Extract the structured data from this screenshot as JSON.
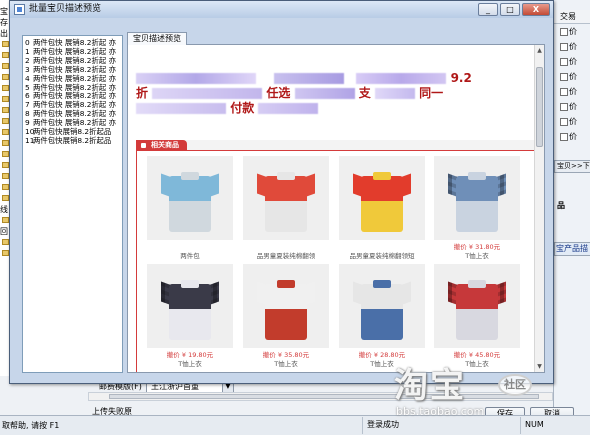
{
  "dialog": {
    "title": "批量宝贝描述预览",
    "controls": {
      "minimize": "_",
      "maximize": "□",
      "close": "X"
    },
    "tab_label": "宝贝描述预览"
  },
  "item_list": [
    {
      "index": "0",
      "text": "两件包快 展销8.2折起 亦"
    },
    {
      "index": "1",
      "text": "两件包快 展销8.2折起 亦"
    },
    {
      "index": "2",
      "text": "两件包快 展销8.2折起 亦"
    },
    {
      "index": "3",
      "text": "两件包快 展销8.2折起 亦"
    },
    {
      "index": "4",
      "text": "两件包快 展销8.2折起 亦"
    },
    {
      "index": "5",
      "text": "两件包快 展销8.2折起 亦"
    },
    {
      "index": "6",
      "text": "两件包快 展销8.2折起 亦"
    },
    {
      "index": "7",
      "text": "两件包快 展销8.2折起 亦"
    },
    {
      "index": "8",
      "text": "两件包快 展销8.2折起 亦"
    },
    {
      "index": "9",
      "text": "两件包快 展销8.2折起 亦"
    },
    {
      "index": "10",
      "text": "两件包快展销8.2折起品"
    },
    {
      "index": "11",
      "text": "两件包快展销8.2折起品"
    }
  ],
  "description": {
    "line1_fragments": [
      "9.2"
    ],
    "line2_fragments": [
      "折",
      "任选",
      "支",
      "同一"
    ],
    "line3_fragments": [
      "付款"
    ]
  },
  "related": {
    "header": "相关商品",
    "products": [
      {
        "price": "",
        "title": "两件包",
        "colors": [
          "#7fb8d9",
          "#d0d8de"
        ]
      },
      {
        "price": "",
        "title": "品男童夏装纯棉翻领",
        "colors": [
          "#e04a3a",
          "#e6e6e6"
        ]
      },
      {
        "price": "",
        "title": "品男童夏装纯棉翻领短",
        "colors": [
          "#e23c2c",
          "#f0c93a"
        ]
      },
      {
        "price": "撤价 ¥ 31.80元",
        "title": "T恤上衣",
        "colors": [
          "#6f8fb8",
          "#c9d3e0"
        ]
      },
      {
        "price": "撤价 ¥ 19.80元",
        "title": "T恤上衣",
        "colors": [
          "#3a3a48",
          "#e8e8ee"
        ]
      },
      {
        "price": "撤价 ¥ 35.80元",
        "title": "T恤上衣",
        "colors": [
          "#f0f0f0",
          "#c23c2c"
        ]
      },
      {
        "price": "撤价 ¥ 28.80元",
        "title": "T恤上衣",
        "colors": [
          "#e6e6e6",
          "#4a6fa8"
        ]
      },
      {
        "price": "撤价 ¥ 45.80元",
        "title": "T恤上衣",
        "colors": [
          "#c6383a",
          "#d8d8e0"
        ]
      }
    ]
  },
  "background": {
    "left_panel_rows": [
      "宝",
      "存",
      "出",
      "",
      "",
      "",
      "",
      "",
      "",
      "",
      "",
      "",
      "",
      "",
      "",
      "",
      "",
      "",
      "线",
      "",
      "回",
      "",
      ""
    ],
    "right_panel": {
      "header": "交易",
      "checkbox_label": "价",
      "button_label": "宝贝>>下载",
      "section_label": "品",
      "tab_label": "宝产品描"
    },
    "bottom": {
      "postage_label": "邮费模版(F)",
      "postage_value": "王江浙沪首重",
      "upload_fail": "上传失败原"
    },
    "save_button": "保存",
    "cancel_button": "取消"
  },
  "statusbar": {
    "help": "取帮助, 请按 F1",
    "login": "登录成功",
    "num": "NUM"
  },
  "watermark": {
    "logo": "淘宝",
    "badge": "社区",
    "url": "bbs.taobao.com"
  }
}
